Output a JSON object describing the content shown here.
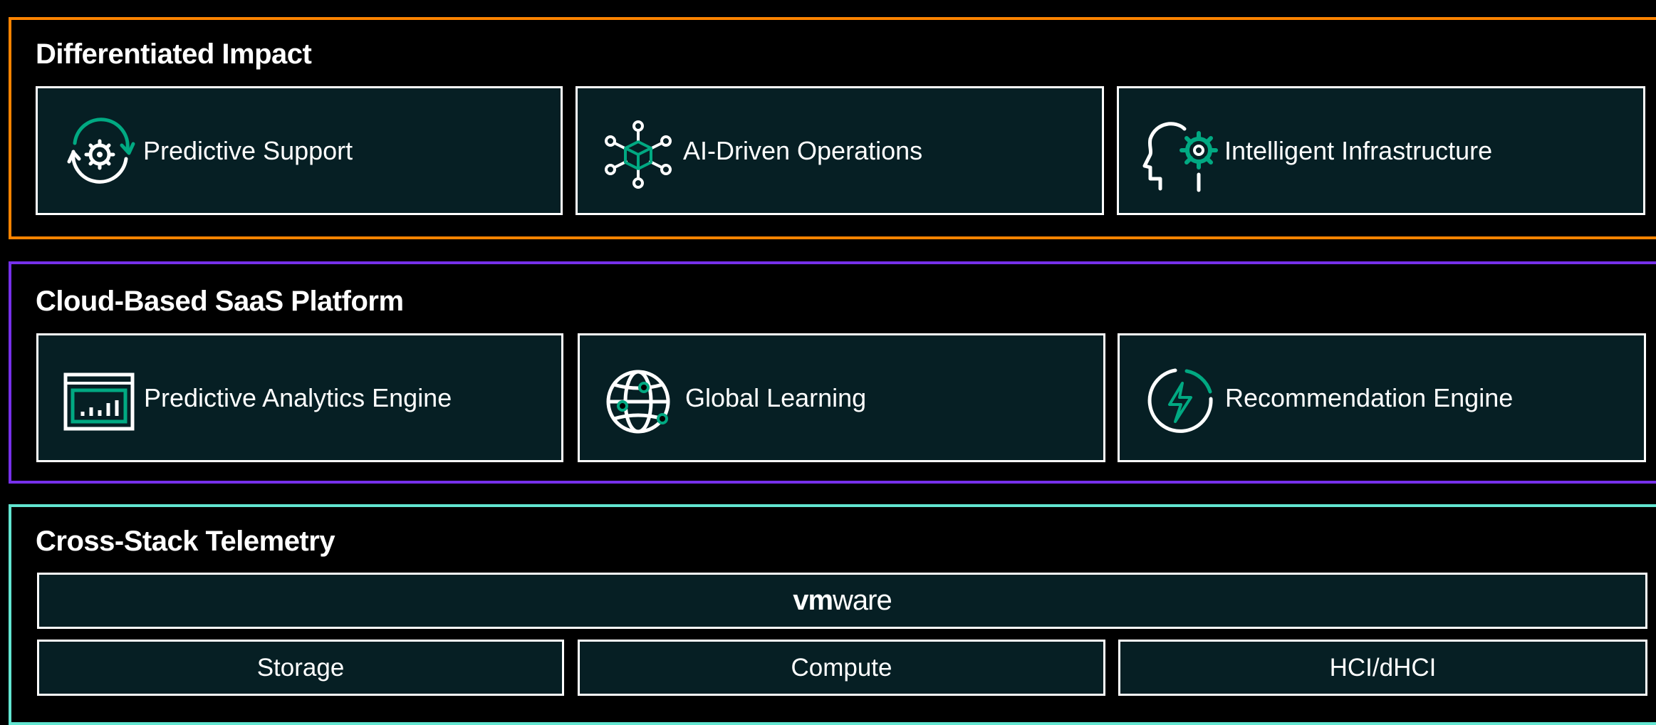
{
  "colors": {
    "background": "#000000",
    "card_fill": "#061f24",
    "card_border": "#ffffff",
    "accent_teal": "#01a982",
    "impact_border": "#ff8300",
    "platform_border": "#7630ea",
    "telemetry_border": "#62e5d0"
  },
  "sections": {
    "impact": {
      "title": "Differentiated Impact",
      "cards": [
        {
          "label": "Predictive Support",
          "icon": "gear-cycle-icon"
        },
        {
          "label": "AI-Driven Operations",
          "icon": "network-cube-icon"
        },
        {
          "label": "Intelligent Infrastructure",
          "icon": "head-gear-icon"
        }
      ]
    },
    "platform": {
      "title": "Cloud-Based SaaS Platform",
      "cards": [
        {
          "label": "Predictive Analytics Engine",
          "icon": "analytics-window-icon"
        },
        {
          "label": "Global Learning",
          "icon": "globe-network-icon"
        },
        {
          "label": "Recommendation Engine",
          "icon": "lightning-circle-icon"
        }
      ]
    },
    "telemetry": {
      "title": "Cross-Stack Telemetry",
      "logo": {
        "vm": "vm",
        "ware": "ware"
      },
      "cells": [
        "Storage",
        "Compute",
        "HCI/dHCI"
      ]
    }
  }
}
